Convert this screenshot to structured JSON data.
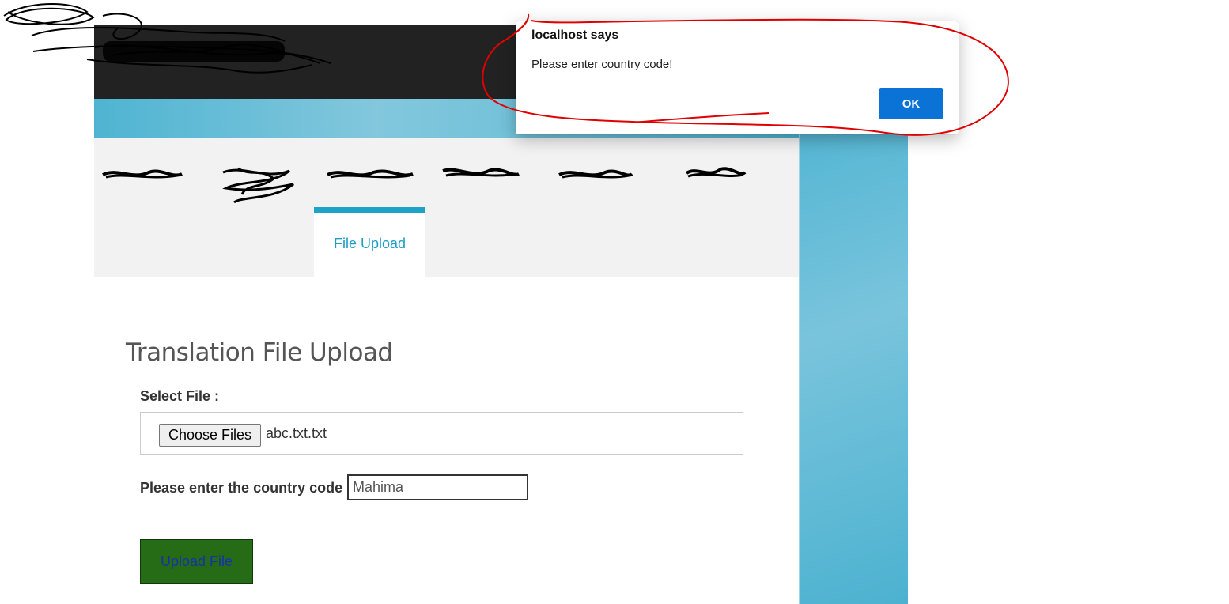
{
  "tabs": {
    "active_label": "File Upload"
  },
  "upload_form": {
    "title": "Translation File Upload",
    "select_file_label": "Select File :",
    "choose_files_label": "Choose Files",
    "selected_file_name": "abc.txt.txt",
    "country_code_label": "Please enter the country code",
    "country_code_value": "Mahima",
    "upload_button_label": "Upload File"
  },
  "dialog": {
    "title": "localhost says",
    "message": "Please enter country code!",
    "ok_label": "OK"
  },
  "colors": {
    "header_bg": "#222222",
    "accent_blue": "#1ea3c8",
    "upload_button_bg": "#266b16",
    "dialog_ok_bg": "#0b72d6",
    "annotation_red": "#e00000"
  }
}
